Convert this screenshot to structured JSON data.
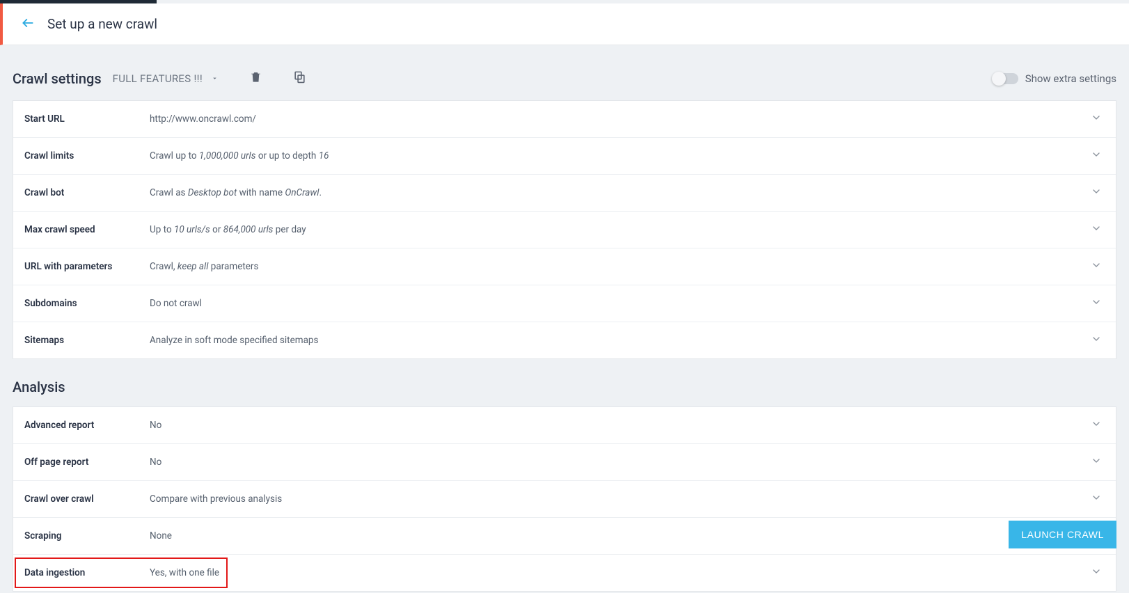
{
  "header": {
    "title": "Set up a new crawl"
  },
  "crawl_settings": {
    "heading": "Crawl settings",
    "profile_label": "FULL FEATURES !!!",
    "extra_toggle_label": "Show extra settings",
    "rows": [
      {
        "label": "Start URL",
        "value_html": "http://www.oncrawl.com/"
      },
      {
        "label": "Crawl limits",
        "value_html": "Crawl up to <em>1,000,000 urls</em> or up to depth <em>16</em>"
      },
      {
        "label": "Crawl bot",
        "value_html": "Crawl as <em>Desktop bot</em> with name <em>OnCrawl</em>."
      },
      {
        "label": "Max crawl speed",
        "value_html": "Up to <em>10 urls/s</em> or <em>864,000 urls</em> per day"
      },
      {
        "label": "URL with parameters",
        "value_html": "Crawl, <em>keep all</em> parameters"
      },
      {
        "label": "Subdomains",
        "value_html": "Do not crawl"
      },
      {
        "label": "Sitemaps",
        "value_html": "Analyze in soft mode specified sitemaps"
      }
    ]
  },
  "analysis": {
    "heading": "Analysis",
    "rows": [
      {
        "label": "Advanced report",
        "value_html": "No"
      },
      {
        "label": "Off page report",
        "value_html": "No"
      },
      {
        "label": "Crawl over crawl",
        "value_html": "Compare with previous analysis"
      },
      {
        "label": "Scraping",
        "value_html": "None"
      },
      {
        "label": "Data ingestion",
        "value_html": "Yes, with one file"
      }
    ]
  },
  "launch_button": "LAUNCH CRAWL"
}
